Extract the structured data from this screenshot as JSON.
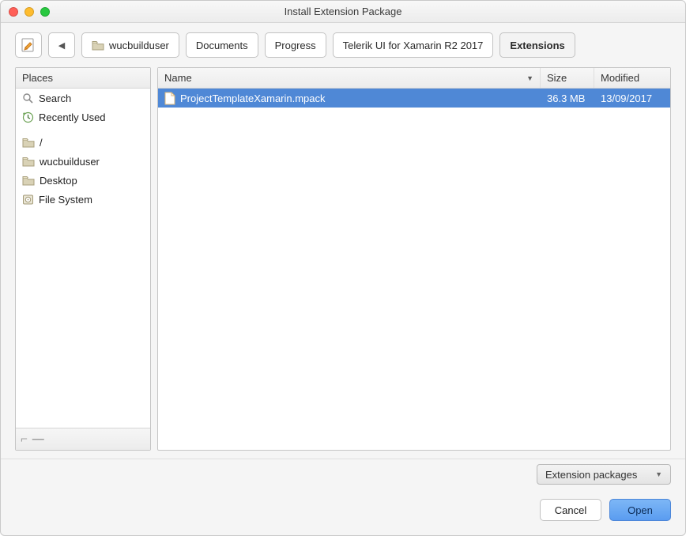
{
  "window": {
    "title": "Install Extension Package"
  },
  "breadcrumb": {
    "back_label": "◀",
    "items": [
      {
        "label": "wucbuilduser",
        "has_icon": true
      },
      {
        "label": "Documents"
      },
      {
        "label": "Progress"
      },
      {
        "label": "Telerik UI for Xamarin R2 2017"
      },
      {
        "label": "Extensions",
        "active": true
      }
    ]
  },
  "sidebar": {
    "header": "Places",
    "items_a": [
      {
        "icon": "search-icon",
        "label": "Search"
      },
      {
        "icon": "recent-icon",
        "label": "Recently Used"
      }
    ],
    "items_b": [
      {
        "icon": "folder-icon",
        "label": "/"
      },
      {
        "icon": "folder-icon",
        "label": "wucbuilduser"
      },
      {
        "icon": "folder-icon",
        "label": "Desktop"
      },
      {
        "icon": "disk-icon",
        "label": "File System"
      }
    ]
  },
  "columns": {
    "name": "Name",
    "size": "Size",
    "modified": "Modified"
  },
  "rows": [
    {
      "name": "ProjectTemplateXamarin.mpack",
      "size": "36.3 MB",
      "modified": "13/09/2017",
      "selected": true
    }
  ],
  "filter": {
    "selected": "Extension packages"
  },
  "actions": {
    "cancel": "Cancel",
    "open": "Open"
  }
}
